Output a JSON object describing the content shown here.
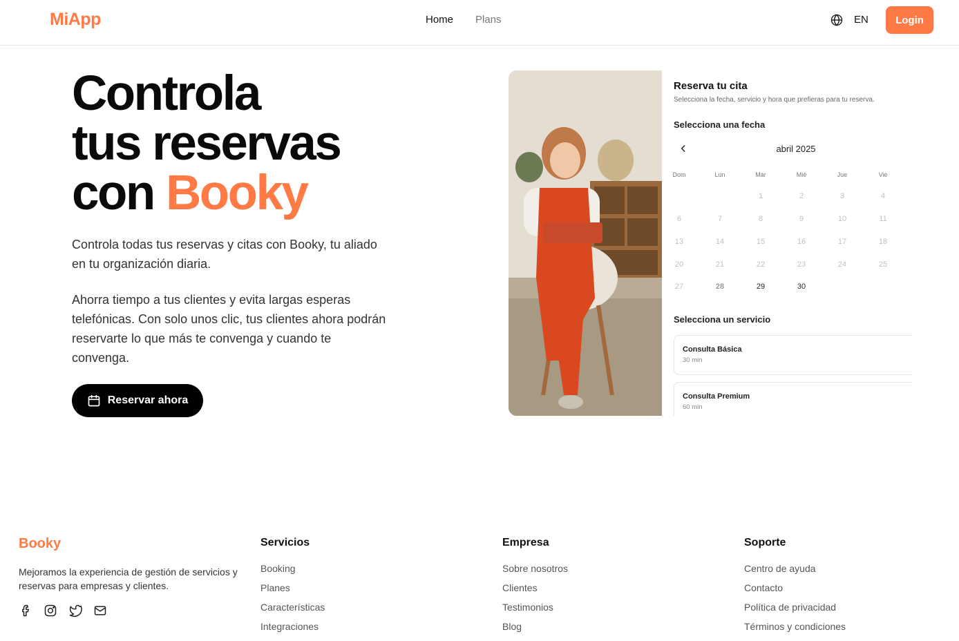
{
  "header": {
    "logo": "MiApp",
    "nav": [
      {
        "label": "Home"
      },
      {
        "label": "Plans"
      }
    ],
    "language": "EN",
    "login": "Login"
  },
  "hero": {
    "title_line1": "Controla",
    "title_line2": "tus reservas",
    "title_line3_prefix": "con ",
    "title_line3_accent": "Booky",
    "paragraph1": "Controla todas tus reservas y citas con Booky, tu aliado en tu organización diaria.",
    "paragraph2": "Ahorra tiempo a tus clientes y evita largas esperas telefónicas. Con solo unos clic, tus clientes ahora podrán reservarte lo que más te convenga y cuando te convenga.",
    "cta": "Reservar ahora"
  },
  "booking": {
    "title": "Reserva tu cita",
    "subtitle": "Selecciona la fecha, servicio y hora que prefieras para tu reserva.",
    "date_label": "Selecciona una fecha",
    "month": "abril 2025",
    "weekdays": [
      "Dom",
      "Lun",
      "Mar",
      "Mié",
      "Jue",
      "Vie"
    ],
    "weeks": [
      [
        "",
        "",
        "1",
        "2",
        "3",
        "4"
      ],
      [
        "6",
        "7",
        "8",
        "9",
        "10",
        "11"
      ],
      [
        "13",
        "14",
        "15",
        "16",
        "17",
        "18"
      ],
      [
        "20",
        "21",
        "22",
        "23",
        "24",
        "25"
      ],
      [
        "27",
        "28",
        "29",
        "30",
        "",
        ""
      ]
    ],
    "service_label": "Selecciona un servicio",
    "services": [
      {
        "name": "Consulta Básica",
        "duration": "30 min"
      },
      {
        "name": "Consulta Premium",
        "duration": "60 min"
      }
    ]
  },
  "footer": {
    "brand": "Booky",
    "description": "Mejoramos la experiencia de gestión de servicios y reservas para empresas y clientes.",
    "social_icons": [
      "facebook-icon",
      "instagram-icon",
      "twitter-icon",
      "mail-icon"
    ],
    "columns": [
      {
        "heading": "Servicios",
        "links": [
          "Booking",
          "Planes",
          "Características",
          "Integraciones"
        ]
      },
      {
        "heading": "Empresa",
        "links": [
          "Sobre nosotros",
          "Clientes",
          "Testimonios",
          "Blog"
        ]
      },
      {
        "heading": "Soporte",
        "links": [
          "Centro de ayuda",
          "Contacto",
          "Política de privacidad",
          "Términos y condiciones"
        ]
      }
    ]
  },
  "colors": {
    "accent": "#ff7a45",
    "text": "#111111",
    "muted": "#777777"
  }
}
